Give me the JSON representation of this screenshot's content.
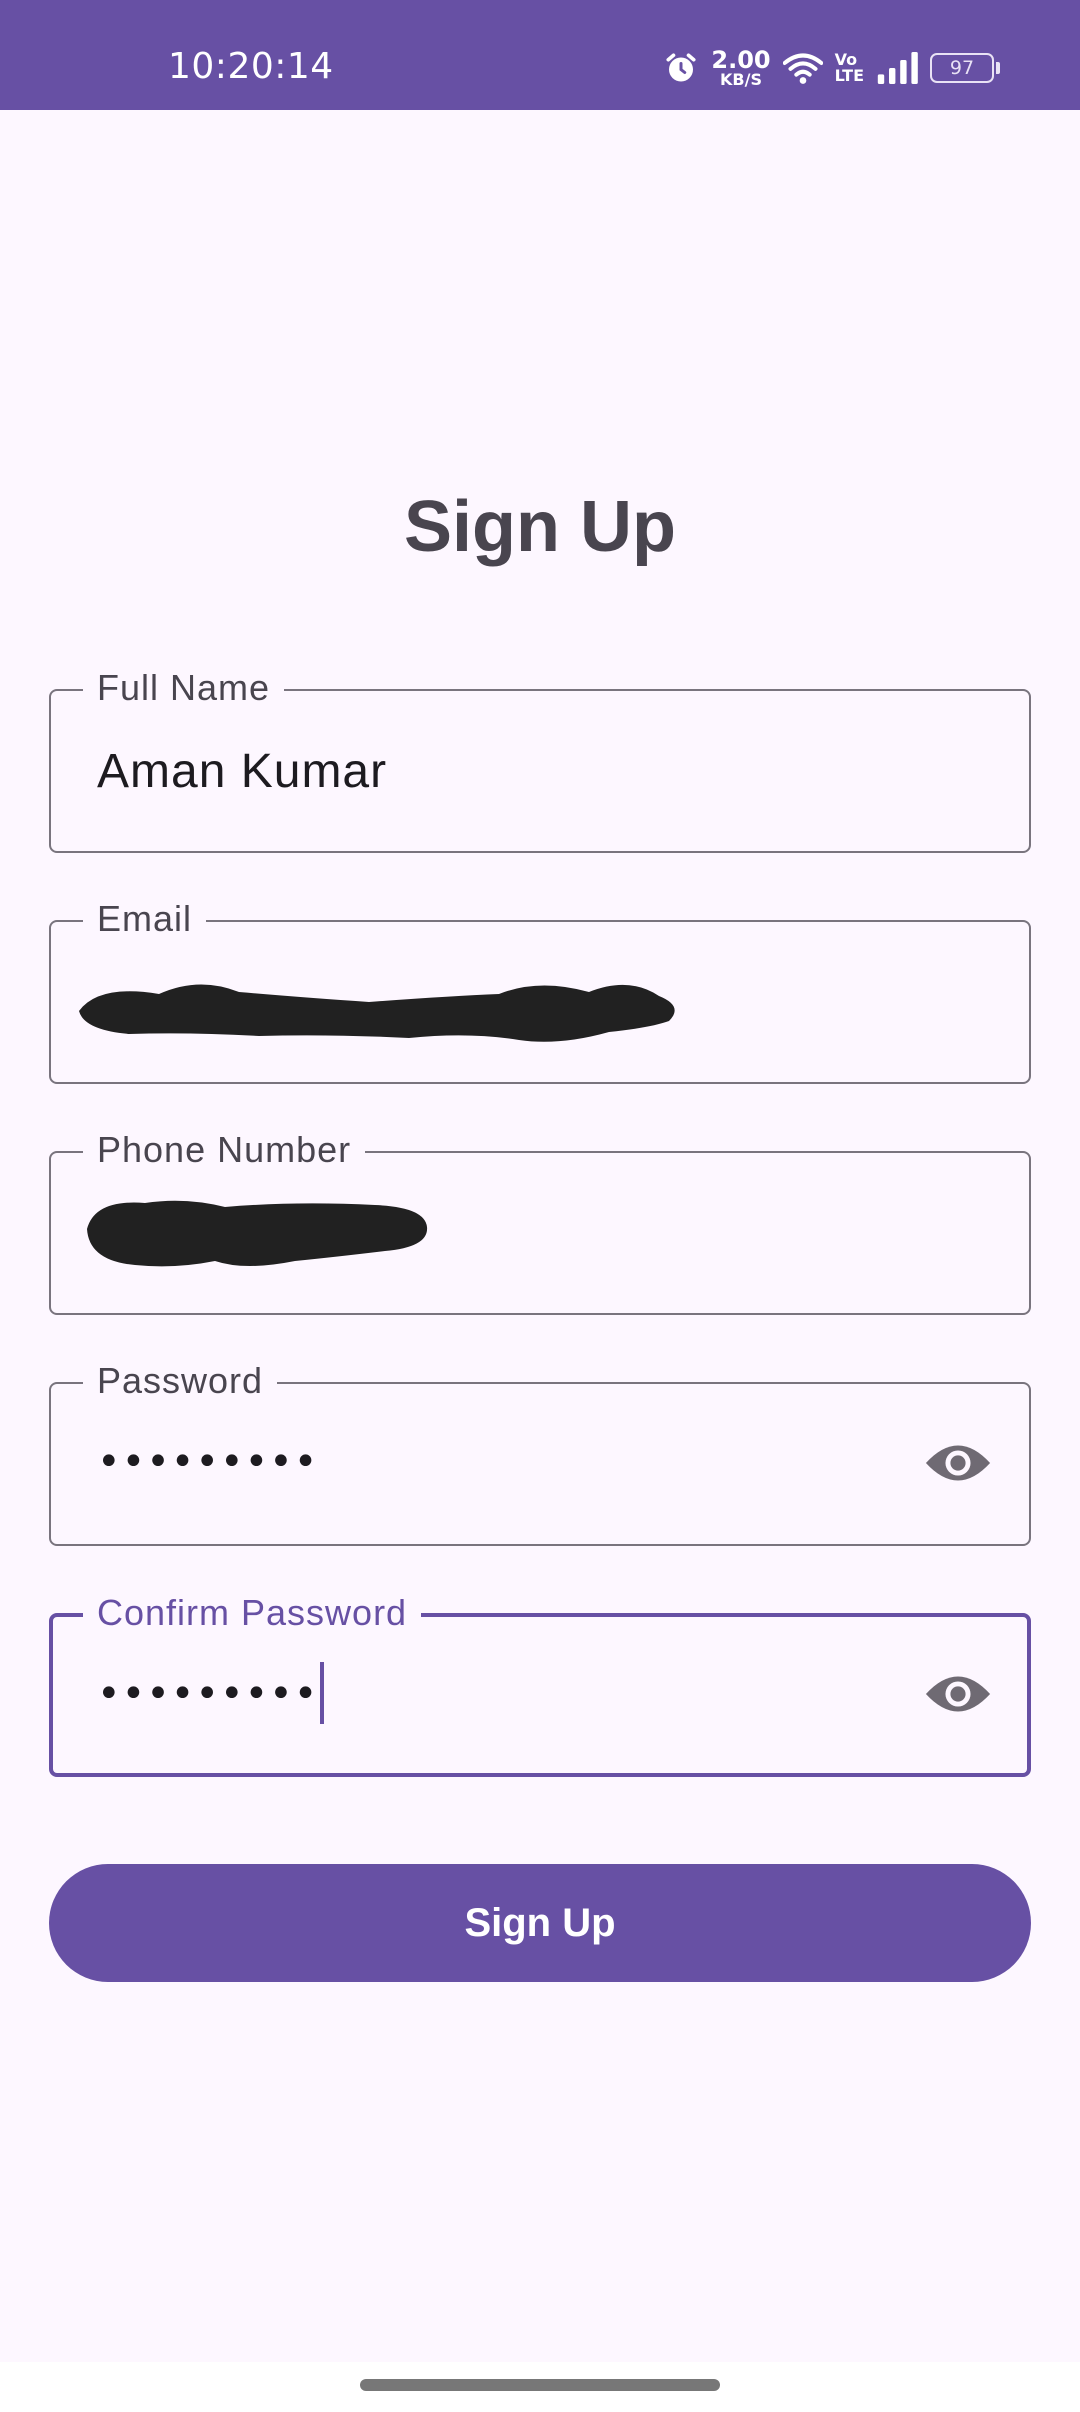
{
  "status_bar": {
    "time": "10:20:14",
    "net_speed_value": "2.00",
    "net_speed_unit": "KB/S",
    "volte_top": "Vo",
    "volte_bottom": "LTE",
    "battery": "97",
    "icons": [
      "alarm-icon",
      "wifi-icon",
      "signal-icon",
      "battery-icon"
    ]
  },
  "title": "Sign Up",
  "form": {
    "full_name": {
      "label": "Full Name",
      "value": "Aman Kumar"
    },
    "email": {
      "label": "Email",
      "value_redacted": true
    },
    "phone": {
      "label": "Phone Number",
      "value_redacted": true
    },
    "password": {
      "label": "Password",
      "masked_value": "•••••••••",
      "toggle_icon": "eye-icon"
    },
    "confirm_password": {
      "label": "Confirm Password",
      "masked_value": "•••••••••",
      "toggle_icon": "eye-icon",
      "focused": true
    }
  },
  "submit_label": "Sign Up",
  "colors": {
    "primary": "#6750a4",
    "background": "#fdf7ff",
    "outline": "#79747e",
    "on_surface": "#1d1b20",
    "on_surface_variant": "#49454f"
  }
}
